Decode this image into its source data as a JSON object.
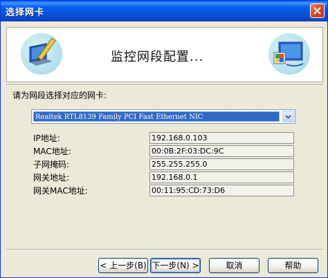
{
  "window": {
    "title": "选择网卡"
  },
  "banner": {
    "title": "监控网段配置..."
  },
  "prompt": "请为网段选择对应的网卡:",
  "nic_select": {
    "selected": "Realtek RTL8139 Family PCI Fast Ethernet NIC"
  },
  "fields": [
    {
      "label": "IP地址:",
      "value": "192.168.0.103"
    },
    {
      "label": "MAC地址:",
      "value": "00:0B:2F:03:DC:9C"
    },
    {
      "label": "子网掩码:",
      "value": "255.255.255.0"
    },
    {
      "label": "网关地址:",
      "value": "192.168.0.1"
    },
    {
      "label": "网关MAC地址:",
      "value": "00:11:95:CD:73:D6"
    }
  ],
  "buttons": {
    "back": "< 上一步(B)",
    "next": "下一步(N) >",
    "cancel": "取消",
    "help": "帮助"
  },
  "icons": {
    "close": "close-icon",
    "banner_left": "monitor-pen-icon",
    "banner_right": "network-screen-icon",
    "dropdown": "chevron-down-icon"
  },
  "colors": {
    "title_bar": "#0A5FE8",
    "selection": "#316AC5",
    "dialog_bg": "#ECE9D8"
  }
}
